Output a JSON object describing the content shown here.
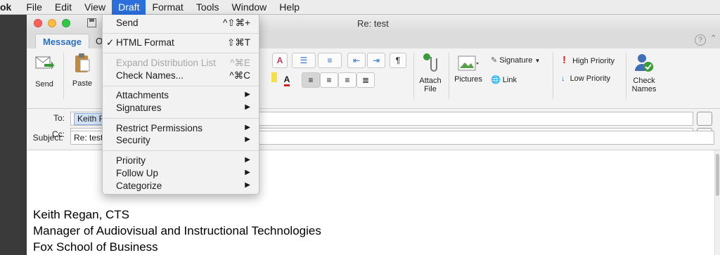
{
  "menubar": {
    "app": "ok",
    "items": [
      "File",
      "Edit",
      "View",
      "Draft",
      "Format",
      "Tools",
      "Window",
      "Help"
    ]
  },
  "window": {
    "title": "Re: test"
  },
  "tabs": {
    "message": "Message",
    "options": "Op"
  },
  "ribbon": {
    "send": "Send",
    "paste": "Paste",
    "attach_file": "Attach File",
    "pictures": "Pictures",
    "signature": "Signature",
    "link": "Link",
    "high_priority": "High Priority",
    "low_priority": "Low Priority",
    "check_names": "Check Names",
    "pilcrow": "¶"
  },
  "header": {
    "to_label": "To:",
    "to_value": "Keith R",
    "cc_label": "Cc:",
    "subject_label": "Subject:",
    "subject_value": "Re: test"
  },
  "signature": {
    "line1": "Keith Regan, CTS",
    "line2": "Manager of Audiovisual and Instructional Technologies",
    "line3": "Fox School of Business"
  },
  "draft_menu": {
    "send": {
      "label": "Send",
      "shortcut": "^⇧⌘+"
    },
    "html_format": {
      "label": "HTML Format",
      "shortcut": "⇧⌘T",
      "checked": true
    },
    "expand_dl": {
      "label": "Expand Distribution List",
      "shortcut": "^⌘E"
    },
    "check_names": {
      "label": "Check Names...",
      "shortcut": "^⌘C"
    },
    "attachments": "Attachments",
    "signatures": "Signatures",
    "restrict": "Restrict Permissions",
    "security": "Security",
    "priority": "Priority",
    "follow_up": "Follow Up",
    "categorize": "Categorize",
    "checkmark": "✓",
    "submenu_arrow": "▶"
  },
  "colors": {
    "accent": "#2a6fdb",
    "tab_blue": "#2c6fc1"
  }
}
